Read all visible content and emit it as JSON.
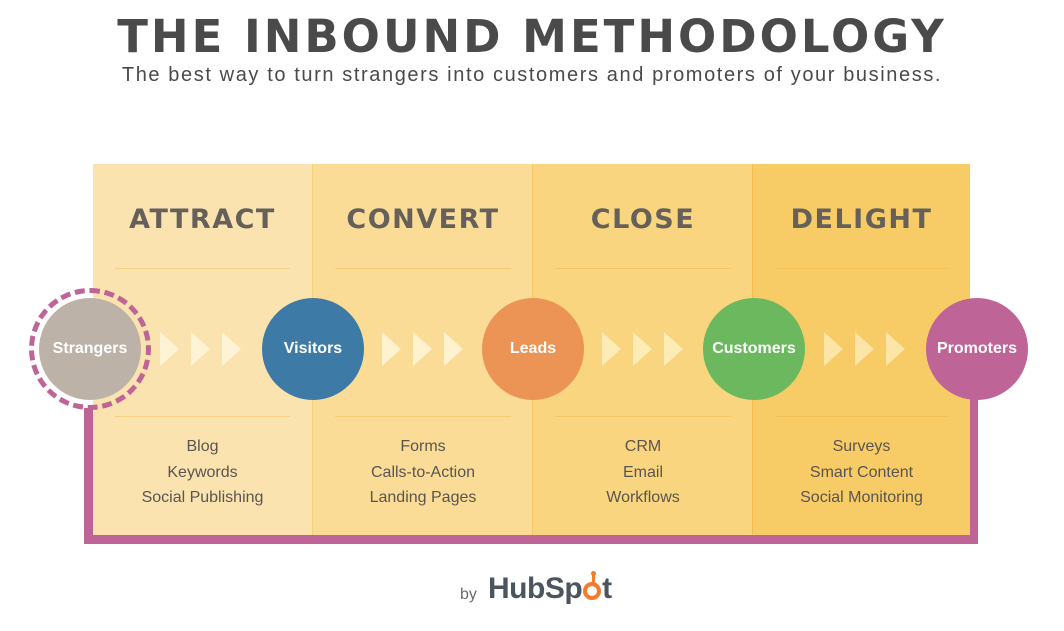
{
  "header": {
    "title": "THE INBOUND METHODOLOGY",
    "subtitle": "The best way to turn strangers into customers and promoters of your business."
  },
  "stages": [
    {
      "label": "ATTRACT",
      "tools": [
        "Blog",
        "Keywords",
        "Social Publishing"
      ],
      "bg_color": "#fbe3b0"
    },
    {
      "label": "CONVERT",
      "tools": [
        "Forms",
        "Calls-to-Action",
        "Landing Pages"
      ],
      "bg_color": "#fadc97"
    },
    {
      "label": "CLOSE",
      "tools": [
        "CRM",
        "Email",
        "Workflows"
      ],
      "bg_color": "#f9d57f"
    },
    {
      "label": "DELIGHT",
      "tools": [
        "Surveys",
        "Smart Content",
        "Social Monitoring"
      ],
      "bg_color": "#f7cb65"
    }
  ],
  "audiences": [
    {
      "label": "Strangers",
      "color": "#bcb2a8"
    },
    {
      "label": "Visitors",
      "color": "#3e7aa6"
    },
    {
      "label": "Leads",
      "color": "#ec9455"
    },
    {
      "label": "Customers",
      "color": "#6bb85e"
    },
    {
      "label": "Promoters",
      "color": "#bf6496"
    }
  ],
  "loop_color": "#bf6496",
  "footer": {
    "by": "by",
    "brand_prefix": "HubSp",
    "brand_suffix": "t",
    "brand_color": "#4a5560",
    "sprocket_color": "#f57a2d"
  }
}
